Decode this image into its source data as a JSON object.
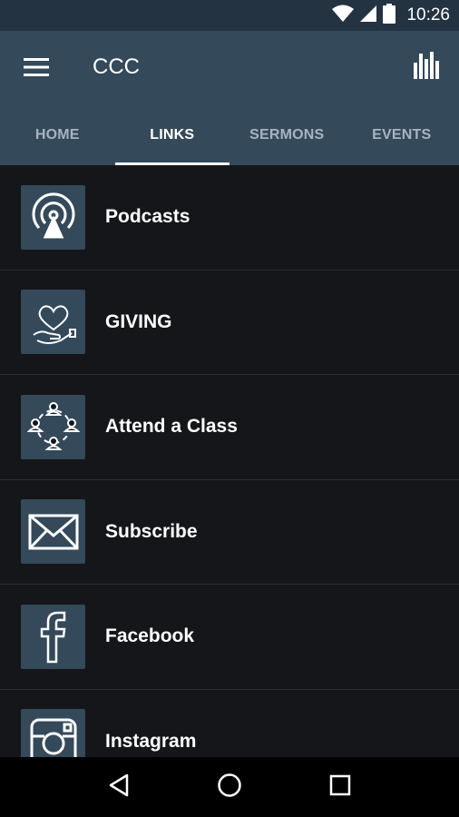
{
  "status_bar": {
    "time": "10:26",
    "icons": [
      "wifi-icon",
      "cell-signal-icon",
      "battery-icon"
    ]
  },
  "app_bar": {
    "title": "CCC",
    "menu_icon": "hamburger-menu-icon",
    "action_icon": "bar-chart-icon"
  },
  "tabs": [
    {
      "label": "HOME",
      "active": false
    },
    {
      "label": "LINKS",
      "active": true
    },
    {
      "label": "SERMONS",
      "active": false
    },
    {
      "label": "EVENTS",
      "active": false
    }
  ],
  "links": [
    {
      "label": "Podcasts",
      "icon": "podcast-icon"
    },
    {
      "label": "GIVING",
      "icon": "heart-hand-icon"
    },
    {
      "label": "Attend a Class",
      "icon": "group-people-icon"
    },
    {
      "label": "Subscribe",
      "icon": "envelope-icon"
    },
    {
      "label": "Facebook",
      "icon": "facebook-icon"
    },
    {
      "label": "Instagram",
      "icon": "instagram-icon"
    }
  ],
  "nav_bar": {
    "icons": [
      "back-icon",
      "home-icon",
      "recents-icon"
    ]
  },
  "colors": {
    "app_bar": "#34495a",
    "status_bar": "#243342",
    "background": "#141619",
    "icon_tile": "#34495a",
    "tab_inactive": "#a7b4bf",
    "text": "#ffffff"
  }
}
